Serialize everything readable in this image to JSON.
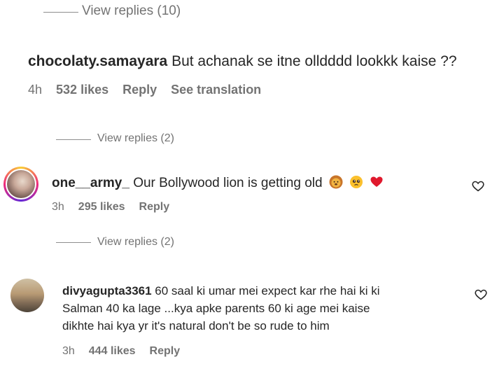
{
  "comments": [
    {
      "view_replies": "View replies (10)"
    },
    {
      "username": "chocolaty.samayara",
      "text": "But achanak se itne olldddd lookkk kaise ??",
      "time": "4h",
      "likes": "532 likes",
      "reply": "Reply",
      "translation": "See translation",
      "view_replies": "View replies (2)"
    },
    {
      "username": "one__army_",
      "text": "Our Bollywood lion is getting old",
      "emoji_icons": [
        "lion-face-icon",
        "pleading-face-icon",
        "red-heart-icon"
      ],
      "time": "3h",
      "likes": "295 likes",
      "reply": "Reply",
      "view_replies": "View replies (2)"
    },
    {
      "username": "divyagupta3361",
      "text_lines": [
        "60 saal ki umar mei expect kar rhe hai ki ki",
        "Salman 40 ka lage ...kya apke parents 60 ki age mei kaise",
        "dikhte hai kya yr it's natural don't be so rude to him"
      ],
      "time": "3h",
      "likes": "444 likes",
      "reply": "Reply"
    }
  ],
  "colors": {
    "primary_text": "#262626",
    "secondary_text": "#737373",
    "divider": "#8e8e8e",
    "heart_red": "#e0192d"
  }
}
